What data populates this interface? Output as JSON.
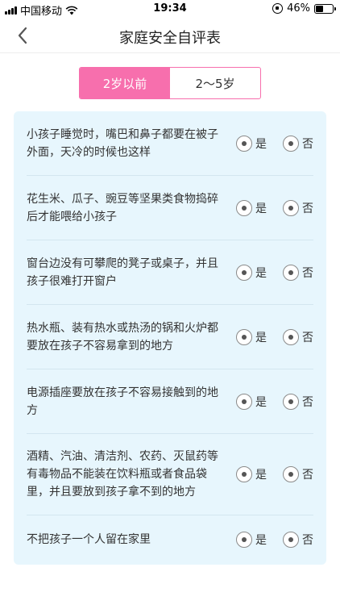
{
  "status_bar": {
    "carrier": "中国移动",
    "time": "19:34",
    "battery": "46%",
    "battery_level": 0.46
  },
  "nav": {
    "title": "家庭安全自评表",
    "back_icon": "chevron-left-icon"
  },
  "tabs": [
    {
      "label": "2岁以前",
      "active": true
    },
    {
      "label": "2～5岁",
      "active": false
    }
  ],
  "options": {
    "yes": "是",
    "no": "否"
  },
  "questions": [
    {
      "text": "小孩子睡觉时，嘴巴和鼻子都要在被子外面，天冷的时候也这样"
    },
    {
      "text": "花生米、瓜子、豌豆等坚果类食物捣碎后才能喂给小孩子"
    },
    {
      "text": "窗台边没有可攀爬的凳子或桌子，并且孩子很难打开窗户"
    },
    {
      "text": "热水瓶、装有热水或热汤的锅和火炉都要放在孩子不容易拿到的地方"
    },
    {
      "text": "电源插座要放在孩子不容易接触到的地方"
    },
    {
      "text": "酒精、汽油、清洁剂、农药、灭鼠药等有毒物品不能装在饮料瓶或者食品袋里，并且要放到孩子拿不到的地方"
    },
    {
      "text": "不把孩子一个人留在家里"
    }
  ]
}
